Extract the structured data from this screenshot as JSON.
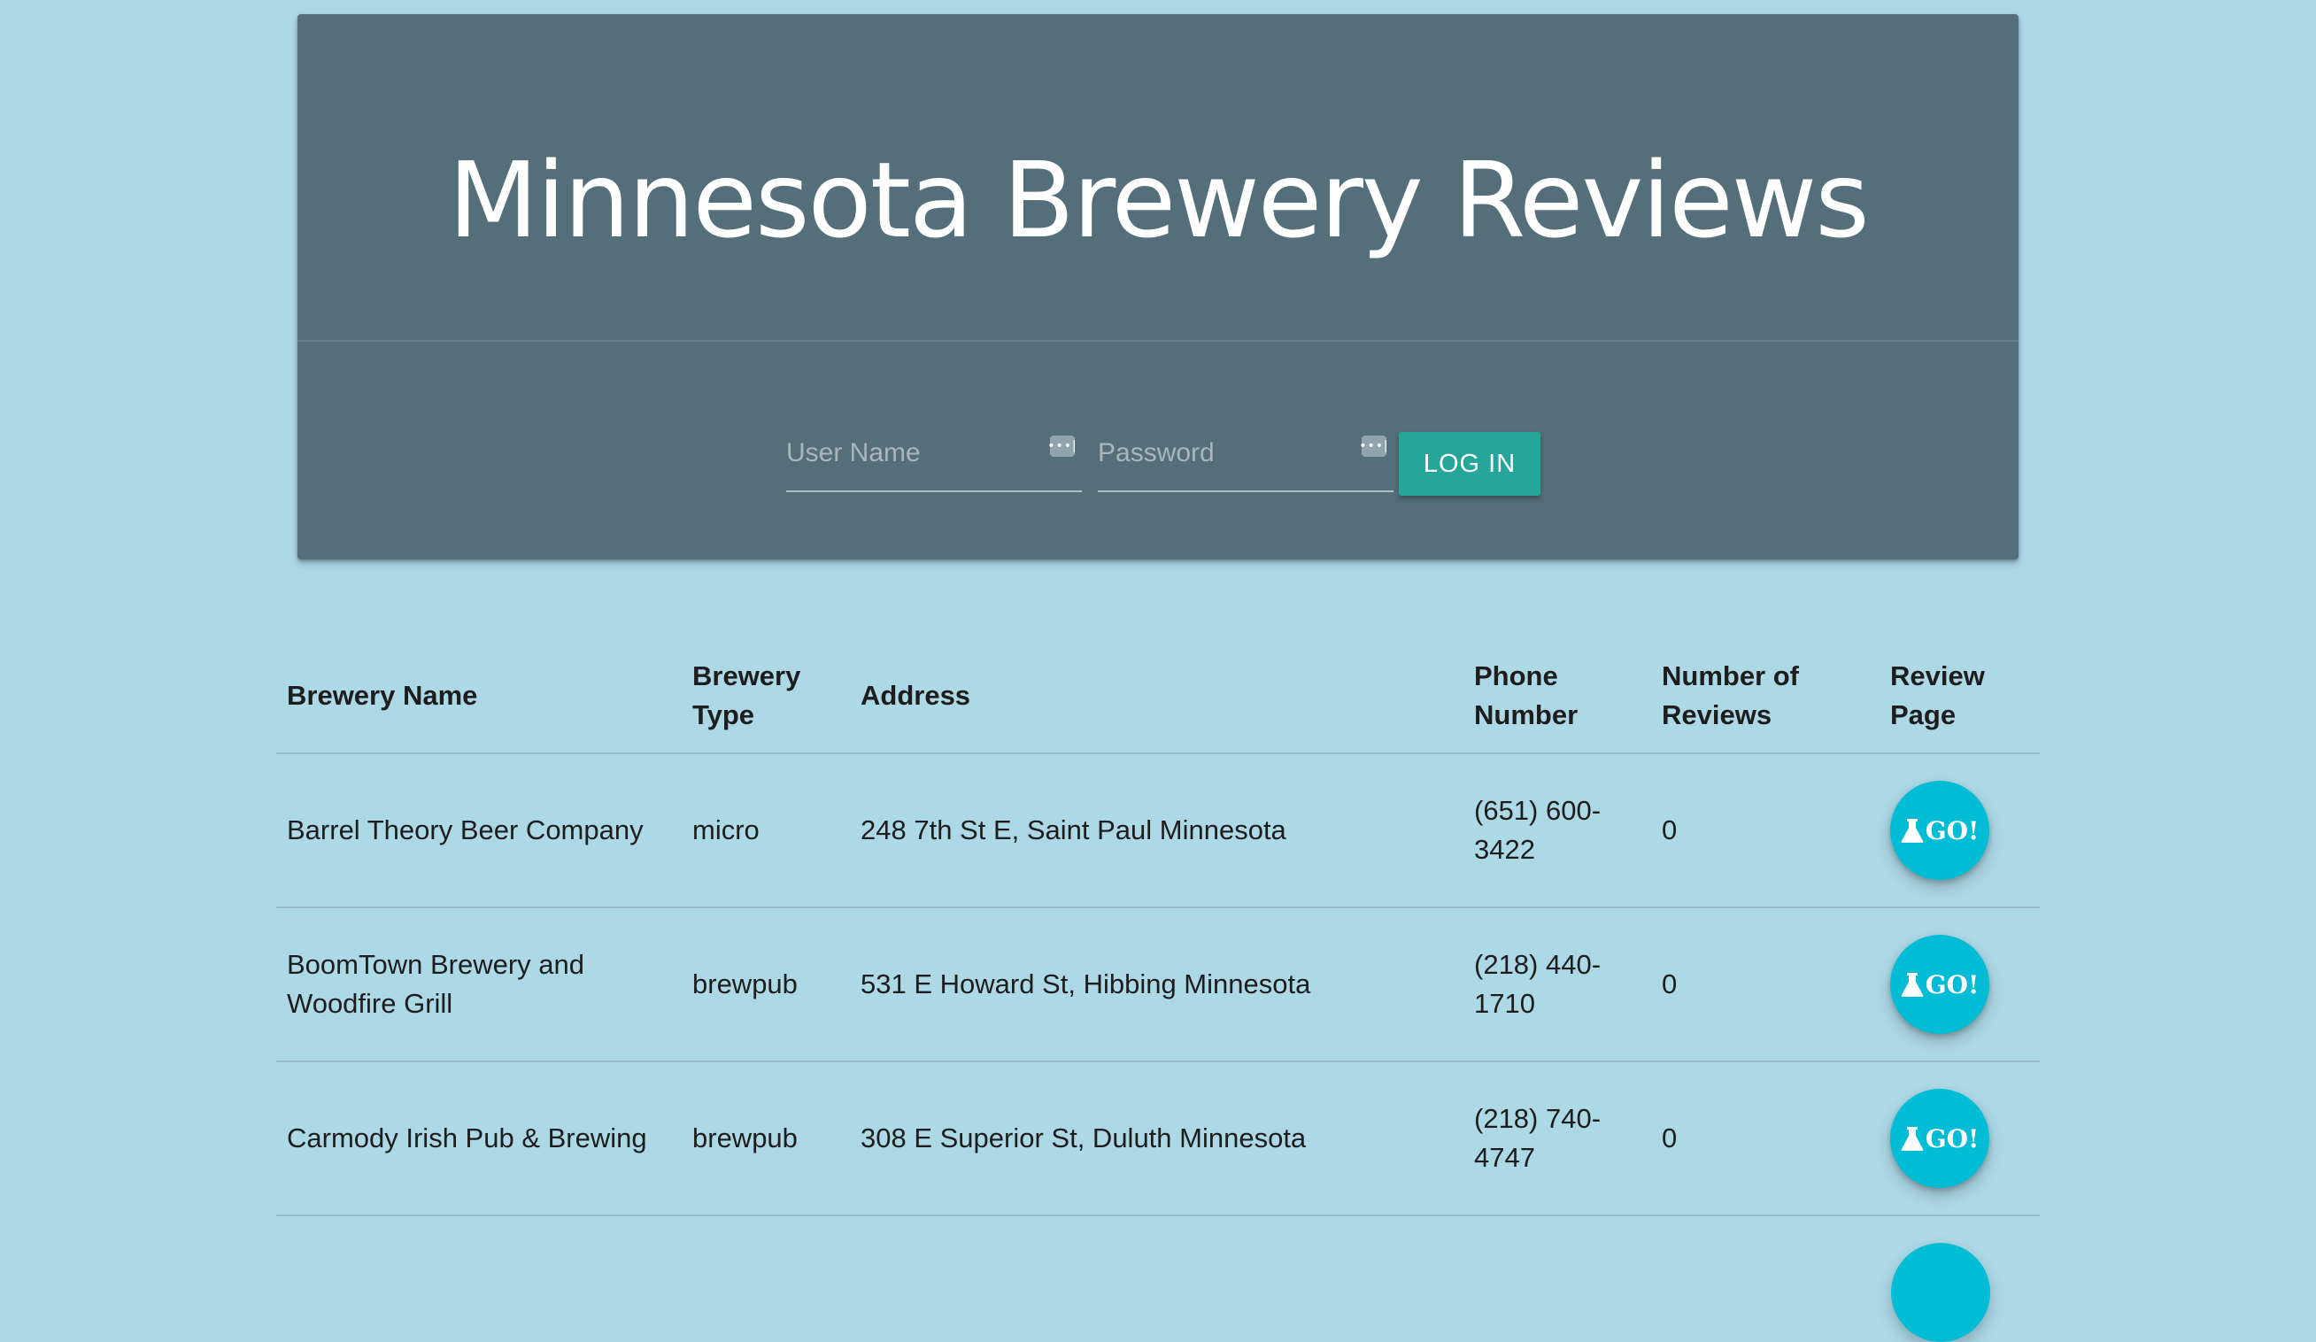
{
  "header": {
    "title": "Minnesota Brewery Reviews"
  },
  "login": {
    "username_placeholder": "User Name",
    "password_placeholder": "Password",
    "username_value": "",
    "password_value": "",
    "button_label": "LOG IN",
    "field_icon": "password-manager-key-icon"
  },
  "table": {
    "headers": {
      "name": "Brewery Name",
      "type": "Brewery Type",
      "address": "Address",
      "phone": "Phone Number",
      "reviews": "Number of Reviews",
      "review_page": "Review Page"
    },
    "rows": [
      {
        "name": "Barrel Theory Beer Company",
        "type": "micro",
        "address": "248 7th St E, Saint Paul Minnesota",
        "phone": "(651) 600-3422",
        "reviews": "0",
        "go_label": "GO!"
      },
      {
        "name": "BoomTown Brewery and Woodfire Grill",
        "type": "brewpub",
        "address": "531 E Howard St, Hibbing Minnesota",
        "phone": "(218) 440-1710",
        "reviews": "0",
        "go_label": "GO!"
      },
      {
        "name": "Carmody Irish Pub & Brewing",
        "type": "brewpub",
        "address": "308 E Superior St, Duluth Minnesota",
        "phone": "(218) 740-4747",
        "reviews": "0",
        "go_label": "GO!"
      }
    ]
  },
  "colors": {
    "page_background": "#add8e6",
    "header_background": "#546e7a",
    "login_button": "#26a69a",
    "go_button": "#00bcd4"
  },
  "icons": {
    "go_button_icon": "flask-icon"
  }
}
